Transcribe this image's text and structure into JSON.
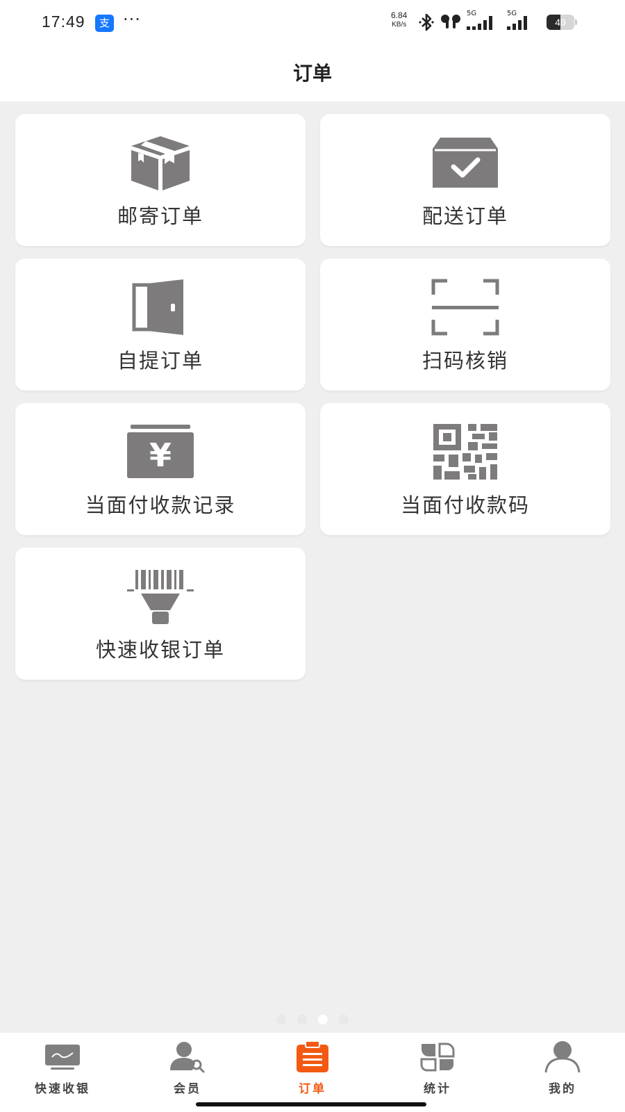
{
  "status_bar": {
    "time": "17:49",
    "alipay_glyph": "支",
    "more": "···",
    "net_speed_value": "6.84",
    "net_speed_unit": "KB/s",
    "signal_1_label": "5G",
    "signal_2_label": "5G",
    "battery_level": "49",
    "icons": [
      "alipay-icon",
      "more-icon",
      "bluetooth-icon",
      "earbuds-icon",
      "signal-icon",
      "battery-icon"
    ]
  },
  "header": {
    "title": "订单"
  },
  "menu": {
    "items": [
      {
        "label": "邮寄订单",
        "icon": "package-box-icon"
      },
      {
        "label": "配送订单",
        "icon": "delivery-check-box-icon"
      },
      {
        "label": "自提订单",
        "icon": "door-icon"
      },
      {
        "label": "扫码核销",
        "icon": "scan-frame-icon"
      },
      {
        "label": "当面付收款记录",
        "icon": "yuan-wallet-icon"
      },
      {
        "label": "当面付收款码",
        "icon": "qr-code-icon"
      },
      {
        "label": "快速收银订单",
        "icon": "barcode-scanner-icon"
      }
    ]
  },
  "pager": {
    "count": 4,
    "active_index": 2
  },
  "tab_bar": {
    "active_index": 2,
    "items": [
      {
        "label": "快速收银",
        "icon": "monitor-icon"
      },
      {
        "label": "会员",
        "icon": "member-search-icon"
      },
      {
        "label": "订单",
        "icon": "order-clipboard-icon"
      },
      {
        "label": "统计",
        "icon": "stats-grid-icon"
      },
      {
        "label": "我的",
        "icon": "profile-icon"
      }
    ]
  },
  "colors": {
    "accent": "#f25a14",
    "icon_gray": "#7d7b7b",
    "background": "#efefef",
    "card": "#ffffff"
  }
}
